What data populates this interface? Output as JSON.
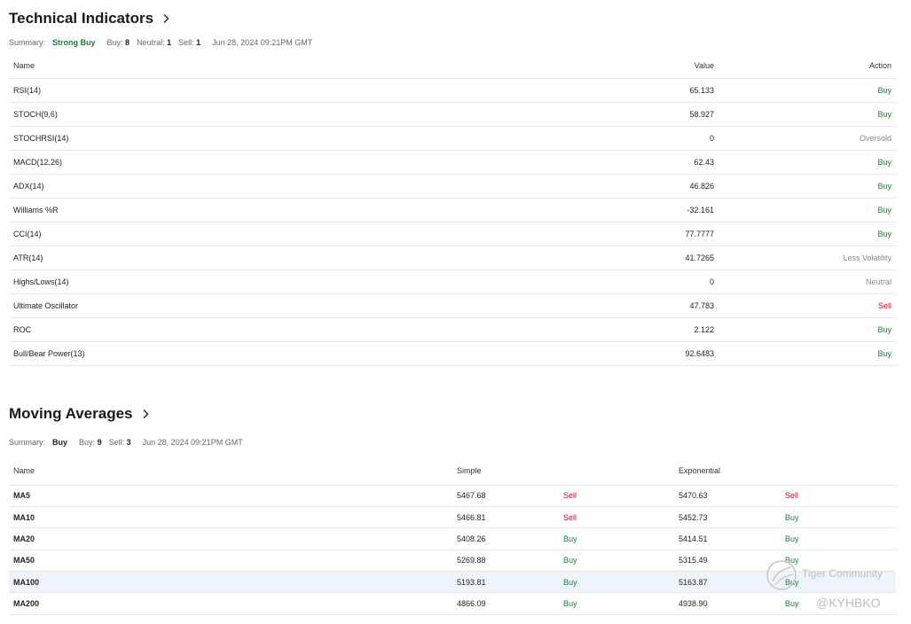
{
  "technical": {
    "title": "Technical Indicators",
    "summary_label": "Summary:",
    "summary_value": "Strong Buy",
    "buy_label": "Buy:",
    "buy_count": "8",
    "neutral_label": "Neutral:",
    "neutral_count": "1",
    "sell_label": "Sell:",
    "sell_count": "1",
    "date": "Jun 28, 2024 09:21PM GMT",
    "headers": {
      "name": "Name",
      "value": "Value",
      "action": "Action"
    },
    "rows": [
      {
        "name": "RSI(14)",
        "value": "65.133",
        "action": "Buy"
      },
      {
        "name": "STOCH(9,6)",
        "value": "58.927",
        "action": "Buy"
      },
      {
        "name": "STOCHRSI(14)",
        "value": "0",
        "action": "Oversold"
      },
      {
        "name": "MACD(12,26)",
        "value": "62.43",
        "action": "Buy"
      },
      {
        "name": "ADX(14)",
        "value": "46.826",
        "action": "Buy"
      },
      {
        "name": "Williams %R",
        "value": "-32.161",
        "action": "Buy"
      },
      {
        "name": "CCI(14)",
        "value": "77.7777",
        "action": "Buy"
      },
      {
        "name": "ATR(14)",
        "value": "41.7265",
        "action": "Less Volatility"
      },
      {
        "name": "Highs/Lows(14)",
        "value": "0",
        "action": "Neutral"
      },
      {
        "name": "Ultimate Oscillator",
        "value": "47.783",
        "action": "Sell"
      },
      {
        "name": "ROC",
        "value": "2.122",
        "action": "Buy"
      },
      {
        "name": "Bull/Bear Power(13)",
        "value": "92.6483",
        "action": "Buy"
      }
    ]
  },
  "moving": {
    "title": "Moving Averages",
    "summary_label": "Summary:",
    "summary_value": "Buy",
    "buy_label": "Buy:",
    "buy_count": "9",
    "sell_label": "Sell:",
    "sell_count": "3",
    "date": "Jun 28, 2024 09:21PM GMT",
    "headers": {
      "name": "Name",
      "simple": "Simple",
      "exponential": "Exponential"
    },
    "rows": [
      {
        "name": "MA5",
        "simple": "5467.68",
        "simple_action": "Sell",
        "exp": "5470.63",
        "exp_action": "Sell"
      },
      {
        "name": "MA10",
        "simple": "5466.81",
        "simple_action": "Sell",
        "exp": "5452.73",
        "exp_action": "Buy"
      },
      {
        "name": "MA20",
        "simple": "5408.26",
        "simple_action": "Buy",
        "exp": "5414.51",
        "exp_action": "Buy"
      },
      {
        "name": "MA50",
        "simple": "5269.88",
        "simple_action": "Buy",
        "exp": "5315.49",
        "exp_action": "Buy"
      },
      {
        "name": "MA100",
        "simple": "5193.81",
        "simple_action": "Buy",
        "exp": "5163.87",
        "exp_action": "Buy"
      },
      {
        "name": "MA200",
        "simple": "4866.09",
        "simple_action": "Buy",
        "exp": "4938.90",
        "exp_action": "Buy"
      }
    ]
  },
  "watermark": {
    "brand": "Tiger Community",
    "handle": "@KYHBKO"
  },
  "colors": {
    "buy": "#1f7a3a",
    "sell": "#d0021b",
    "neutral": "#888888",
    "highlight_row": "#eef4fb"
  }
}
